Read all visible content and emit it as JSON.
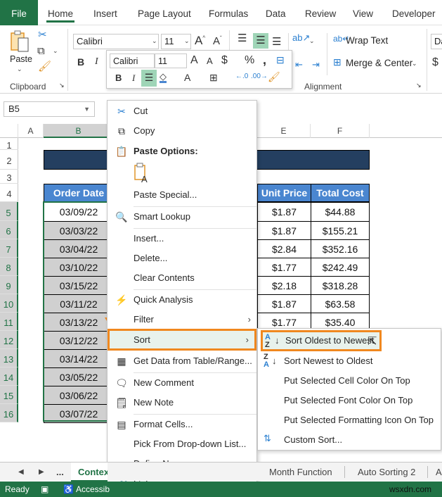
{
  "ribbon_tabs": [
    "File",
    "Home",
    "Insert",
    "Page Layout",
    "Formulas",
    "Data",
    "Review",
    "View",
    "Developer"
  ],
  "active_tab": "Home",
  "clipboard": {
    "paste_label": "Paste",
    "group_label": "Clipboard"
  },
  "font": {
    "name": "Calibri",
    "size": "11",
    "bold": "B",
    "italic": "I"
  },
  "alignment": {
    "wrap_text": "Wrap Text",
    "merge_center": "Merge & Center",
    "group_label": "Alignment"
  },
  "number_format_partial": "Da",
  "mini_toolbar": {
    "font": "Calibri",
    "size": "11"
  },
  "name_box": "B5",
  "columns": [
    "A",
    "B",
    "E",
    "F"
  ],
  "rows": [
    "1",
    "2",
    "3",
    "4",
    "5",
    "6",
    "7",
    "8",
    "9",
    "10",
    "11",
    "12",
    "13",
    "14",
    "15",
    "16"
  ],
  "table": {
    "headers": {
      "order_date": "Order Date",
      "unit_price": "Unit Price",
      "total_cost": "Total Cost"
    },
    "order_dates": [
      "03/09/22",
      "03/03/22",
      "03/04/22",
      "03/10/22",
      "03/15/22",
      "03/11/22",
      "03/13/22",
      "03/12/22",
      "03/14/22",
      "03/05/22",
      "03/06/22",
      "03/07/22"
    ],
    "unit_prices": [
      "$1.87",
      "$1.87",
      "$2.84",
      "$1.77",
      "$2.18",
      "$1.87",
      "$1.77"
    ],
    "total_costs": [
      "$44.88",
      "$155.21",
      "$352.16",
      "$242.49",
      "$318.28",
      "$63.58",
      "$35.40"
    ]
  },
  "context_menu": {
    "cut": "Cut",
    "copy": "Copy",
    "paste_options": "Paste Options:",
    "paste_special": "Paste Special...",
    "smart_lookup": "Smart Lookup",
    "insert": "Insert...",
    "delete": "Delete...",
    "clear_contents": "Clear Contents",
    "quick_analysis": "Quick Analysis",
    "filter": "Filter",
    "sort": "Sort",
    "get_data": "Get Data from Table/Range...",
    "new_comment": "New Comment",
    "new_note": "New Note",
    "format_cells": "Format Cells...",
    "pick_list": "Pick From Drop-down List...",
    "define_name": "Define Name...",
    "link": "Link"
  },
  "sort_submenu": {
    "oldest_newest": "Sort Oldest to Newest",
    "newest_oldest": "Sort Newest to Oldest",
    "cell_color": "Put Selected Cell Color On Top",
    "font_color": "Put Selected Font Color On Top",
    "format_icon": "Put Selected Formatting Icon On Top",
    "custom_sort": "Custom Sort..."
  },
  "sheet_tabs": {
    "ellipsis": "...",
    "active": "Contex",
    "month_function": "Month Function",
    "auto_sorting_2": "Auto Sorting 2",
    "partial": "A"
  },
  "status": {
    "ready": "Ready",
    "accessibility": "Accessib",
    "watermark": "wsxdn.com"
  },
  "colors": {
    "excel_green": "#217346",
    "highlight_orange": "#f0881f",
    "header_blue": "#4a86d0",
    "title_navy": "#243f60"
  }
}
